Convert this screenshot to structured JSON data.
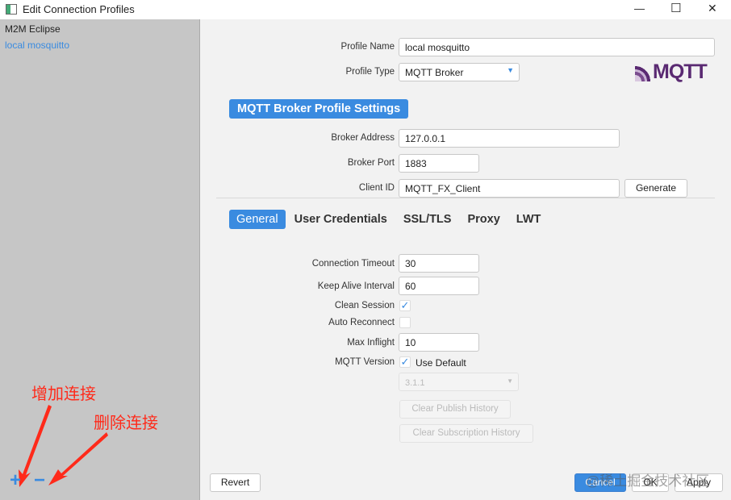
{
  "window": {
    "title": "Edit Connection Profiles",
    "minimize": "—",
    "maximize": "☐",
    "close": "✕"
  },
  "sidebar": {
    "items": [
      {
        "label": "M2M Eclipse",
        "selected": false
      },
      {
        "label": "local mosquitto",
        "selected": true
      }
    ],
    "add": "+",
    "remove": "−"
  },
  "annotations": {
    "add": "增加连接",
    "remove": "删除连接",
    "color": "#ff2a1a"
  },
  "profile": {
    "name_label": "Profile Name",
    "name_value": "local mosquitto",
    "type_label": "Profile Type",
    "type_value": "MQTT Broker",
    "logo": "MQTT"
  },
  "section_title": "MQTT Broker Profile Settings",
  "broker": {
    "address_label": "Broker Address",
    "address_value": "127.0.0.1",
    "port_label": "Broker Port",
    "port_value": "1883",
    "client_label": "Client ID",
    "client_value": "MQTT_FX_Client",
    "generate": "Generate"
  },
  "tabs": [
    {
      "label": "General",
      "active": true
    },
    {
      "label": "User Credentials"
    },
    {
      "label": "SSL/TLS"
    },
    {
      "label": "Proxy"
    },
    {
      "label": "LWT"
    }
  ],
  "general": {
    "timeout_label": "Connection Timeout",
    "timeout_value": "30",
    "keepalive_label": "Keep Alive Interval",
    "keepalive_value": "60",
    "clean_label": "Clean Session",
    "clean_checked": true,
    "auto_label": "Auto Reconnect",
    "auto_checked": false,
    "inflight_label": "Max Inflight",
    "inflight_value": "10",
    "version_label": "MQTT Version",
    "use_default_label": "Use Default",
    "use_default_checked": true,
    "version_value": "3.1.1",
    "clear_publish": "Clear Publish History",
    "clear_subscription": "Clear Subscription History"
  },
  "footer": {
    "revert": "Revert",
    "cancel": "Cancel",
    "ok": "OK",
    "apply": "Apply"
  },
  "watermark": "@稀土掘金技术社区",
  "colors": {
    "accent": "#3a8be0",
    "sidebar": "#c6c6c6"
  }
}
